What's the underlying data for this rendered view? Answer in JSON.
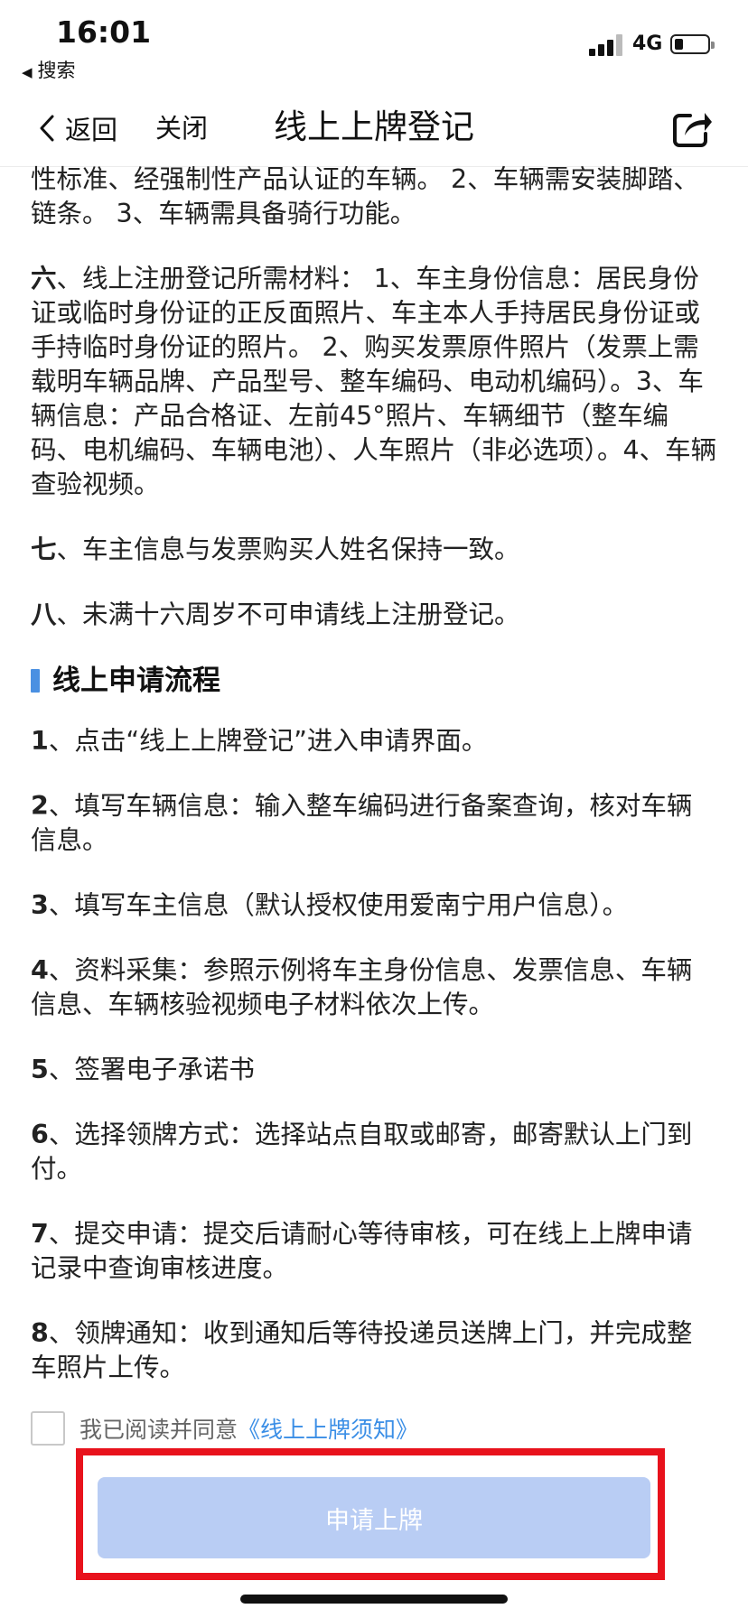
{
  "status_bar": {
    "time": "16:01",
    "back_app": "搜索",
    "network": "4G"
  },
  "nav": {
    "back_label": "返回",
    "close_label": "关闭",
    "title": "线上上牌登记"
  },
  "content": {
    "top_partial": "性标准、经强制性产品认证的车辆。 2、车辆需安装脚踏、链条。 3、车辆需具备骑行功能。",
    "requirements": [
      {
        "num": "六",
        "text": "、线上注册登记所需材料： 1、车主身份信息：居民身份证或临时身份证的正反面照片、车主本人手持居民身份证或手持临时身份证的照片。 2、购买发票原件照片（发票上需载明车辆品牌、产品型号、整车编码、电动机编码）。3、车辆信息：产品合格证、左前45°照片、车辆细节（整车编码、电机编码、车辆电池）、人车照片（非必选项）。4、车辆查验视频。"
      },
      {
        "num": "七",
        "text": "、车主信息与发票购买人姓名保持一致。"
      },
      {
        "num": "八",
        "text": "、未满十六周岁不可申请线上注册登记。"
      }
    ],
    "section_title": "线上申请流程",
    "steps": [
      {
        "num": "1",
        "text": "、点击“线上上牌登记”进入申请界面。"
      },
      {
        "num": "2",
        "text": "、填写车辆信息：输入整车编码进行备案查询，核对车辆信息。"
      },
      {
        "num": "3",
        "text": "、填写车主信息（默认授权使用爱南宁用户信息）。"
      },
      {
        "num": "4",
        "text": "、资料采集：参照示例将车主身份信息、发票信息、车辆信息、车辆核验视频电子材料依次上传。"
      },
      {
        "num": "5",
        "text": "、签署电子承诺书"
      },
      {
        "num": "6",
        "text": "、选择领牌方式：选择站点自取或邮寄，邮寄默认上门到付。"
      },
      {
        "num": "7",
        "text": "、提交申请：提交后请耐心等待审核，可在线上上牌申请记录中查询审核进度。"
      },
      {
        "num": "8",
        "text": "、领牌通知：收到通知后等待投递员送牌上门，并完成整车照片上传。"
      }
    ]
  },
  "agreement": {
    "text": "我已阅读并同意",
    "link": "《线上上牌须知》",
    "checked": false
  },
  "apply_button": {
    "label": "申请上牌",
    "enabled": false
  },
  "colors": {
    "accent": "#4a90e2",
    "link": "#3a8ee6",
    "button_disabled": "#b9cdf4",
    "highlight_frame": "#e8121c"
  }
}
